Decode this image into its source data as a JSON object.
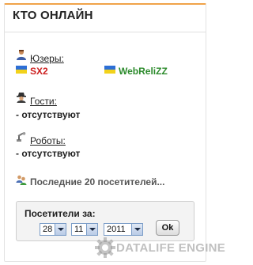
{
  "widget": {
    "title": "КТО ОНЛАЙН",
    "accent_color": "#f0a349"
  },
  "users": {
    "label": "Юзеры:",
    "icon": "user-icon",
    "list": [
      {
        "name": "SX2",
        "color": "#cc1f1f",
        "flag_icon": "ukraine-flag-icon"
      },
      {
        "name": "WebReliZZ",
        "color": "#2b8a2b",
        "flag_icon": "ukraine-flag-icon"
      }
    ]
  },
  "guests": {
    "label": "Гости:",
    "icon": "spy-icon",
    "value": "- отсутствуют"
  },
  "robots": {
    "label": "Роботы:",
    "icon": "robot-arm-icon",
    "value": "- отсутствуют"
  },
  "last_visitors": {
    "label": "Последние 20 посетителей...",
    "icon": "users-group-icon"
  },
  "visitors_box": {
    "label": "Посетители за:",
    "day": "28",
    "month": "11",
    "year": "2011",
    "ok_label": "Ok"
  },
  "watermark": {
    "text": "DATALIFE ENGINE",
    "icon": "gear-icon"
  }
}
